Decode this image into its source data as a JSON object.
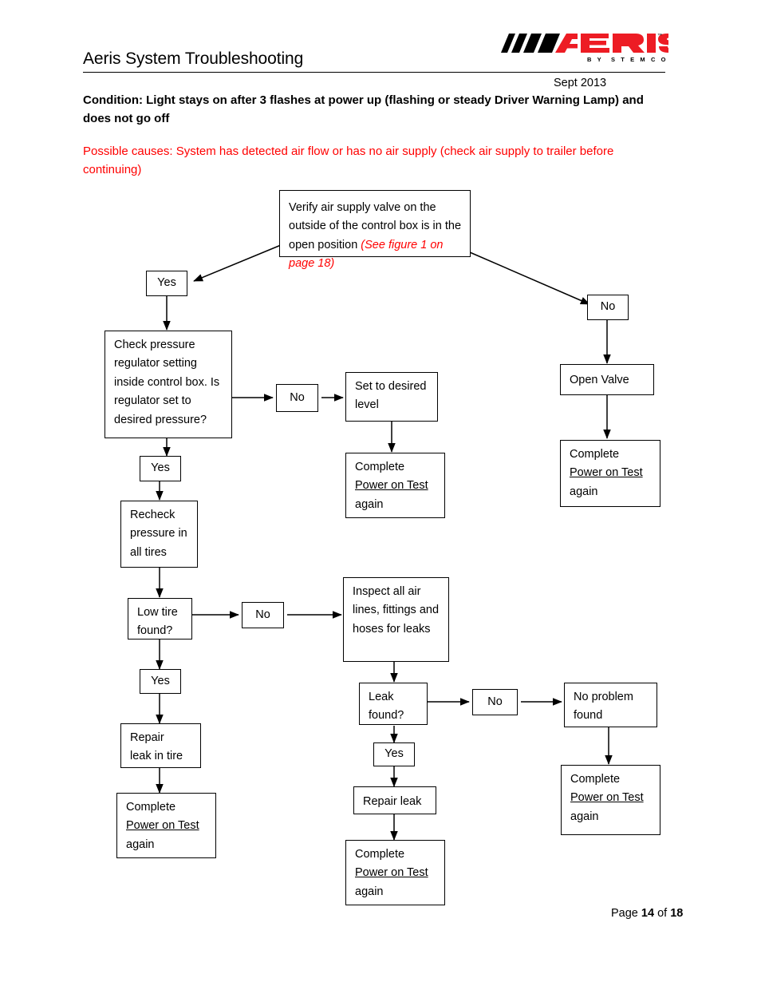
{
  "header": {
    "title": "Aeris System Troubleshooting",
    "date": "Sept 2013",
    "logo": {
      "brand": "AERIS",
      "tagline": "BY STEMCO",
      "trademark": "™",
      "brand_color": "#ED1C24",
      "slash_color": "#000000"
    },
    "condition": "Condition: Light stays on after 3 flashes at power up (flashing or steady Driver Warning Lamp) and does not go off",
    "possible_causes": "Possible causes: System has detected air flow or has no air supply (check air supply to trailer before continuing)",
    "causes_color": "#FF0000"
  },
  "flowchart": {
    "nodes": {
      "verify_valve": {
        "text_plain": "Verify air supply valve on the outside of the control box is in the open position ",
        "text_red_italic": "(See figure 1 on page 18)"
      },
      "yes_1": "Yes",
      "no_1": "No",
      "check_regulator": "Check pressure regulator setting inside control box. Is regulator set to desired pressure?",
      "no_2": "No",
      "set_level": "Set to desired level",
      "complete_1_line1": "Complete",
      "complete_1_line2": "Power on Test",
      "complete_1_line3": "again",
      "open_valve": "Open Valve",
      "complete_2_line1": "Complete",
      "complete_2_line2": "Power on Test",
      "complete_2_line3": "again",
      "yes_2": "Yes",
      "recheck_pressure": "Recheck pressure in all tires",
      "low_tire": "Low tire found?",
      "no_3": "No",
      "inspect_lines": "Inspect all air lines, fittings and hoses for leaks",
      "yes_3": "Yes",
      "repair_leak_tire_line1": "Repair",
      "repair_leak_tire_line2": "leak in tire",
      "complete_3_line1": "Complete",
      "complete_3_line2": "Power on Test",
      "complete_3_line3": "again",
      "leak_found": "Leak found?",
      "no_4": "No",
      "no_problem": "No problem found",
      "yes_4": "Yes",
      "repair_leak": "Repair leak",
      "complete_4_line1": "Complete",
      "complete_4_line2": "Power on Test",
      "complete_4_line3": "again",
      "complete_5_line1": "Complete",
      "complete_5_line2": "Power on Test",
      "complete_5_line3": "again"
    }
  },
  "footer": {
    "prefix": "Page ",
    "current": "14",
    "middle": " of ",
    "total": "18"
  }
}
